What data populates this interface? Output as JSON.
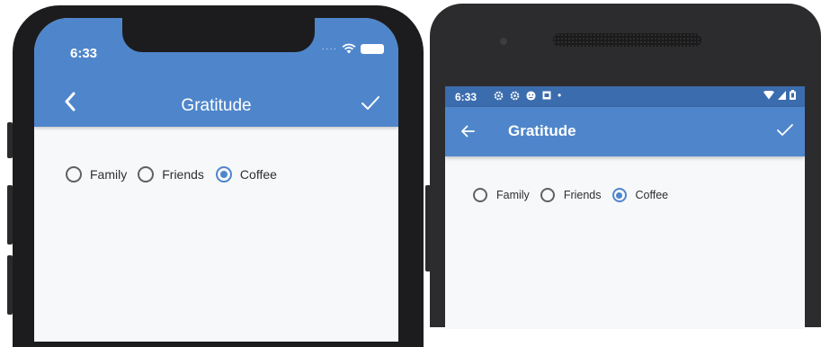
{
  "ios": {
    "status_time": "6:33",
    "title": "Gratitude",
    "back_icon": "chevron-left-icon",
    "confirm_icon": "check-icon",
    "radio_options": [
      {
        "label": "Family",
        "selected": false
      },
      {
        "label": "Friends",
        "selected": false
      },
      {
        "label": "Coffee",
        "selected": true
      }
    ]
  },
  "android": {
    "status_time": "6:33",
    "title": "Gratitude",
    "back_icon": "arrow-left-icon",
    "confirm_icon": "check-icon",
    "radio_options": [
      {
        "label": "Family",
        "selected": false
      },
      {
        "label": "Friends",
        "selected": false
      },
      {
        "label": "Coffee",
        "selected": true
      }
    ]
  },
  "colors": {
    "app_bar": "#4f86cb",
    "android_status_bar": "#3b6cad",
    "radio_selected": "#4f86cb",
    "background": "#f7f8fa"
  }
}
